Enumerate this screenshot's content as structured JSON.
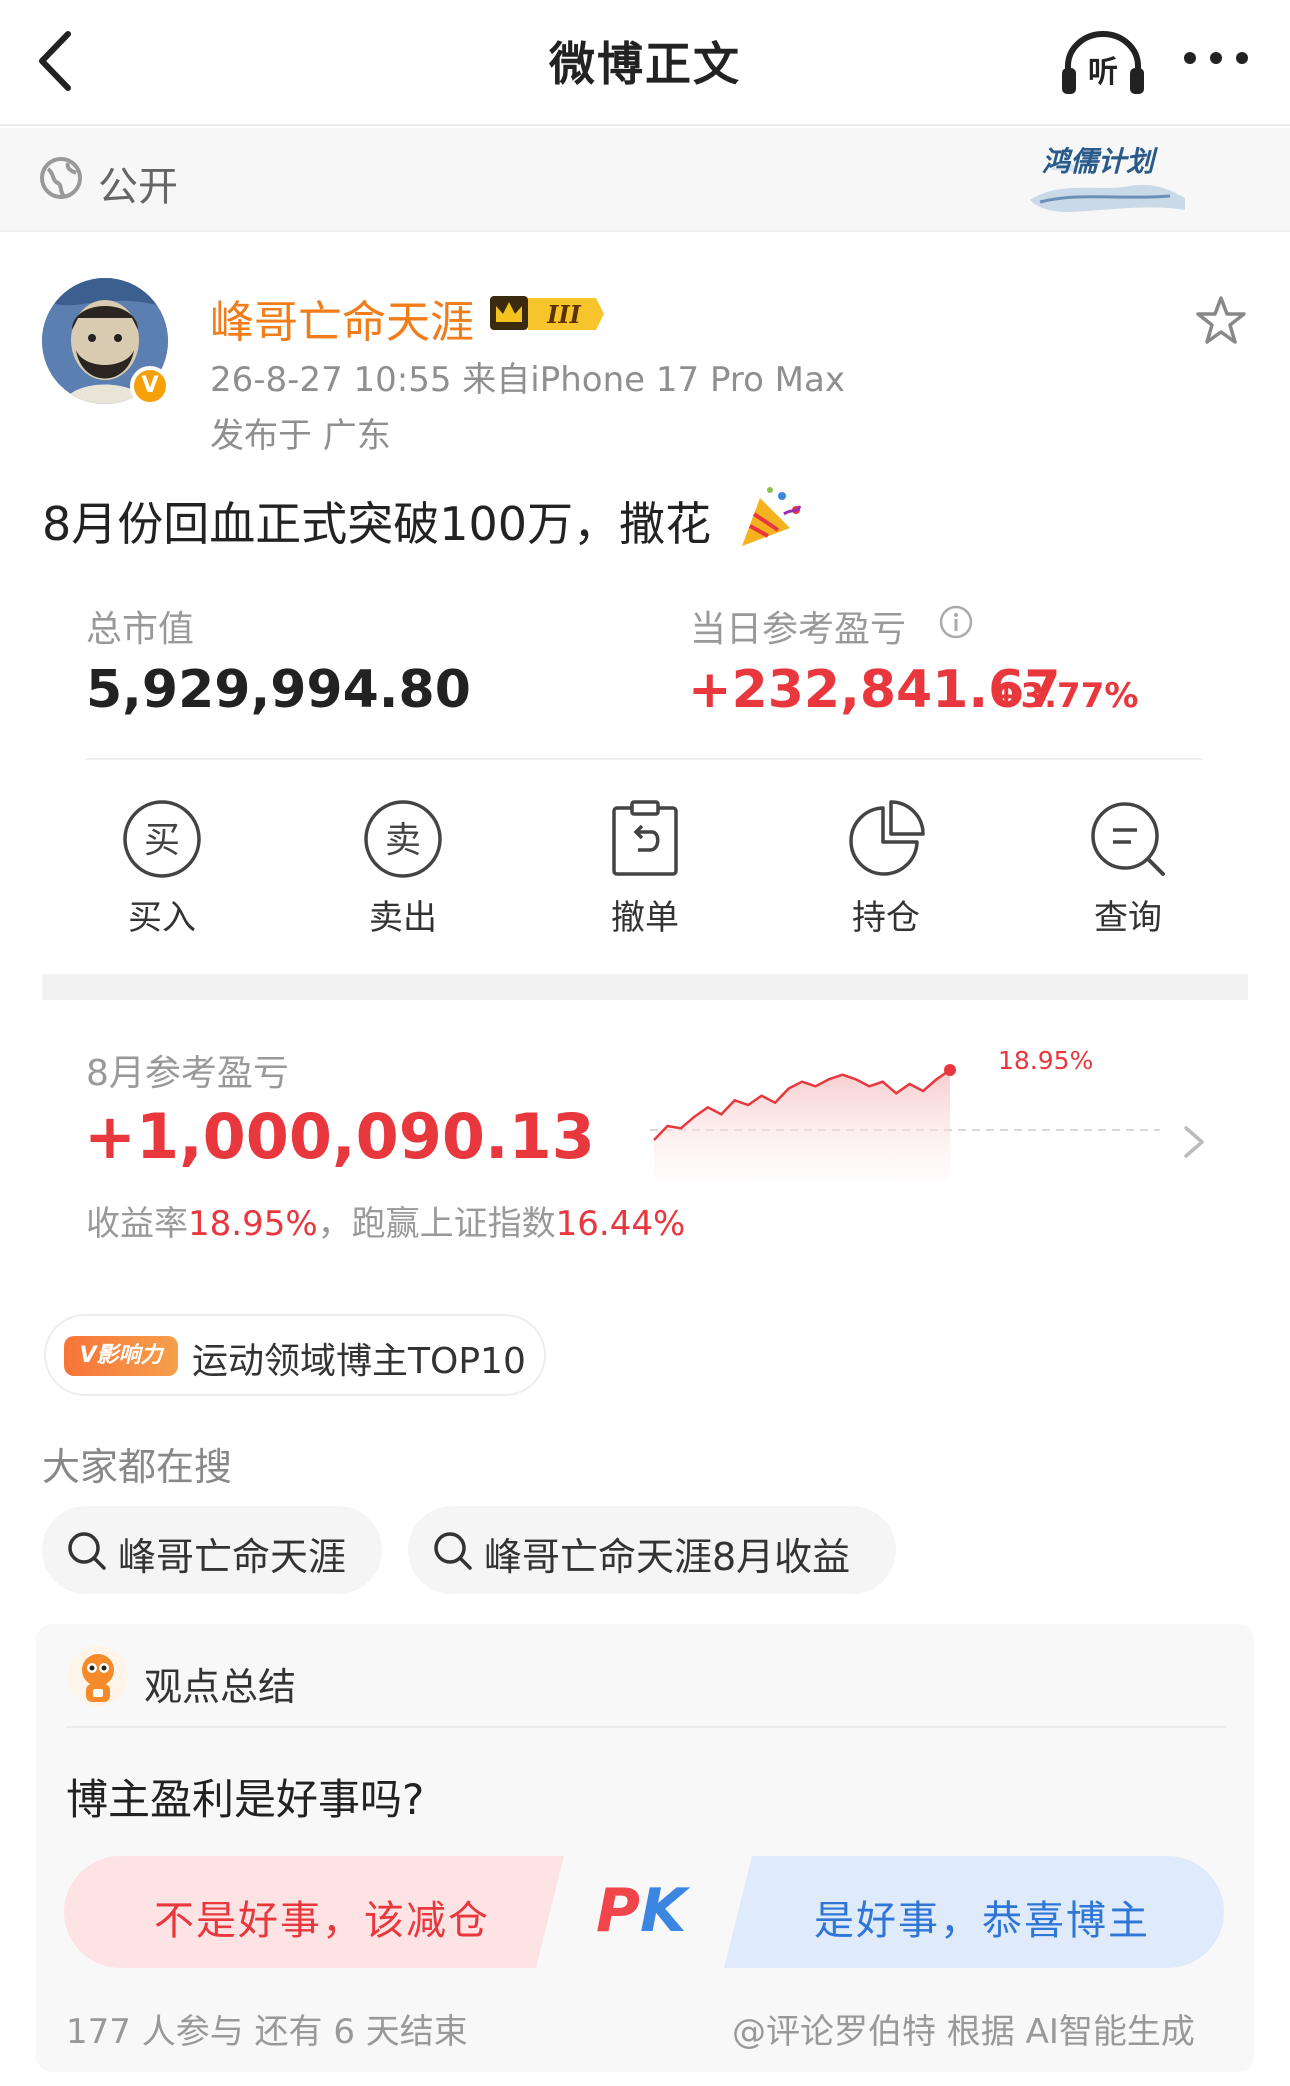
{
  "header": {
    "title": "微博正文",
    "listen_label": "听"
  },
  "visibility": {
    "label": "公开",
    "honor_badge": "鸿儒计划"
  },
  "author": {
    "name": "峰哥亡命天涯",
    "verify_mark": "V",
    "level_badge": "III",
    "meta": "26-8-27 10:55  来自iPhone 17 Pro Max",
    "location": "发布于 广东"
  },
  "post": {
    "text": "8月份回血正式突破100万，撒花"
  },
  "portfolio": {
    "total_label": "总市值",
    "total_value": "5,929,994.80",
    "daily_label": "当日参考盈亏",
    "daily_value": "+232,841.67",
    "daily_pct": "+3.77%"
  },
  "actions": [
    {
      "label": "买入",
      "glyph": "买",
      "icon": "buy-icon"
    },
    {
      "label": "卖出",
      "glyph": "卖",
      "icon": "sell-icon"
    },
    {
      "label": "撤单",
      "icon": "cancel-order-icon"
    },
    {
      "label": "持仓",
      "icon": "pie-chart-icon"
    },
    {
      "label": "查询",
      "icon": "search-icon"
    }
  ],
  "monthly": {
    "label": "8月参考盈亏",
    "value": "+1,000,090.13",
    "desc_prefix": "收益率",
    "return_rate": "18.95%",
    "desc_mid": "，跑赢上证指数",
    "beat_index": "16.44%",
    "peak_label": "18.95%"
  },
  "chart_data": {
    "type": "area",
    "series": [
      {
        "values": [
          0,
          0.6,
          0.5,
          1.0,
          1.4,
          1.1,
          1.7,
          1.5,
          1.9,
          1.6,
          2.2,
          2.5,
          2.3,
          2.6,
          2.8,
          2.6,
          2.3,
          2.5,
          2.0,
          2.4,
          2.1,
          2.6,
          3.0
        ]
      }
    ]
  },
  "influence": {
    "badge": "V影响力",
    "text": "运动领域博主TOP10"
  },
  "search": {
    "title": "大家都在搜",
    "chips": [
      "峰哥亡命天涯",
      "峰哥亡命天涯8月收益"
    ]
  },
  "viewpoint": {
    "title": "观点总结",
    "question": "博主盈利是好事吗?",
    "left_option": "不是好事，该减仓",
    "right_option": "是好事，恭喜博主",
    "pk_p": "P",
    "pk_k": "K",
    "stats": "177 人参与   还有 6 天结束",
    "credit": "@评论罗伯特  根据 AI智能生成"
  },
  "colors": {
    "accent_red": "#e8383d",
    "accent_orange": "#f07c1a",
    "accent_blue": "#2f76d6"
  }
}
